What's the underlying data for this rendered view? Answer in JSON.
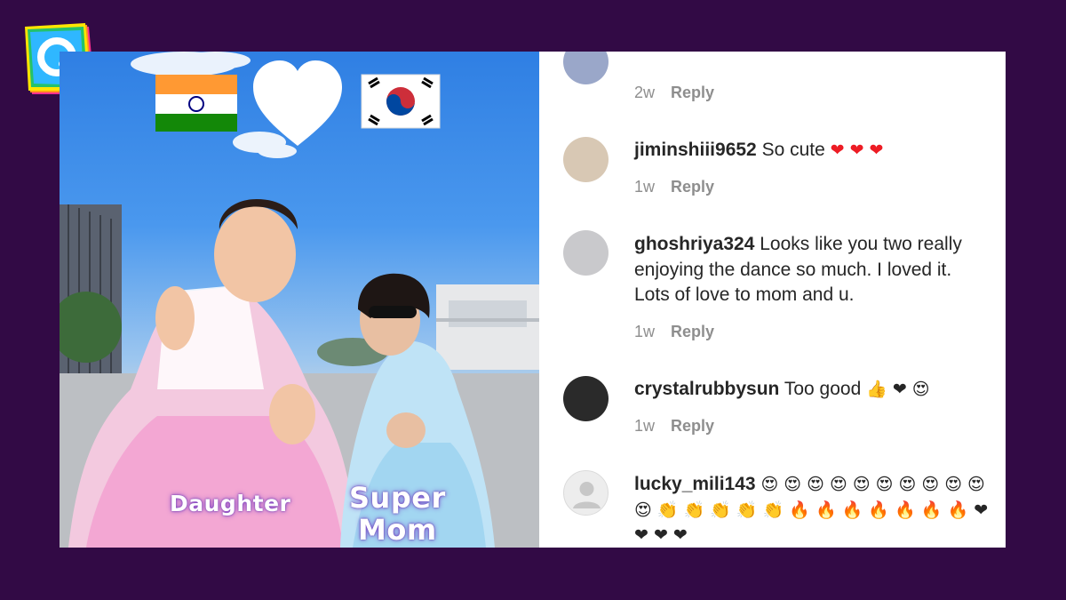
{
  "brand": {
    "logo_letter": "Q"
  },
  "video": {
    "top_emojis": [
      "indian-flag",
      "white-heart",
      "south-korea-flag"
    ],
    "label_left": "Daughter",
    "label_right_line1": "Super",
    "label_right_line2": "Mom"
  },
  "comments": [
    {
      "username": "",
      "text": "",
      "time": "2w",
      "reply": "Reply"
    },
    {
      "username": "jiminshiii9652",
      "text": "So cute",
      "emojis": "❤ ❤ ❤",
      "time": "1w",
      "reply": "Reply"
    },
    {
      "username": "ghoshriya324",
      "text": "Looks like you two really enjoying the dance so much. I loved it. Lots of love to mom and u.",
      "time": "1w",
      "reply": "Reply"
    },
    {
      "username": "crystalrubbysun",
      "text": "Too good",
      "emojis": "👍 ❤ 😍",
      "time": "1w",
      "reply": "Reply"
    },
    {
      "username": "lucky_mili143",
      "text": "",
      "emojis": "😍 😍 😍 😍 😍 😍 😍 😍 😍 😍 😍 👏 👏 👏 👏 👏 🔥 🔥 🔥 🔥 🔥 🔥 🔥 ❤ ❤ ❤ ❤",
      "time": "",
      "reply": ""
    }
  ],
  "colors": {
    "background": "#320a45",
    "heart": "#ed1c24",
    "meta": "#8e8e8e"
  }
}
